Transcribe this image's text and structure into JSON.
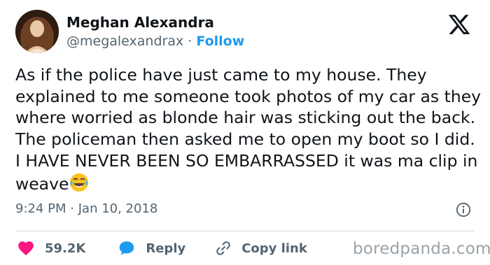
{
  "author": {
    "name": "Meghan Alexandra",
    "handle": "@megalexandrax",
    "separator": "·",
    "follow_label": "Follow"
  },
  "tweet": {
    "text": "As if the police have just came to my house. They explained to me someone took photos of my car as they where worried as blonde hair was sticking out the back. The policeman then asked me to open my boot so I did. I HAVE NEVER BEEN SO EMBARRASSED it was ma clip in weave",
    "emoji": "face-with-tears-of-joy"
  },
  "meta": {
    "time": "9:24 PM",
    "separator": "·",
    "date": "Jan 10, 2018"
  },
  "actions": {
    "likes": "59.2K",
    "reply_label": "Reply",
    "copy_label": "Copy link"
  },
  "watermark": "boredpanda.com",
  "colors": {
    "accent": "#1d9bf0",
    "like": "#f91880",
    "muted": "#536471",
    "text": "#0f1419"
  },
  "icons": [
    "x-logo-icon",
    "info-icon",
    "heart-icon",
    "reply-bubble-icon",
    "link-icon"
  ]
}
